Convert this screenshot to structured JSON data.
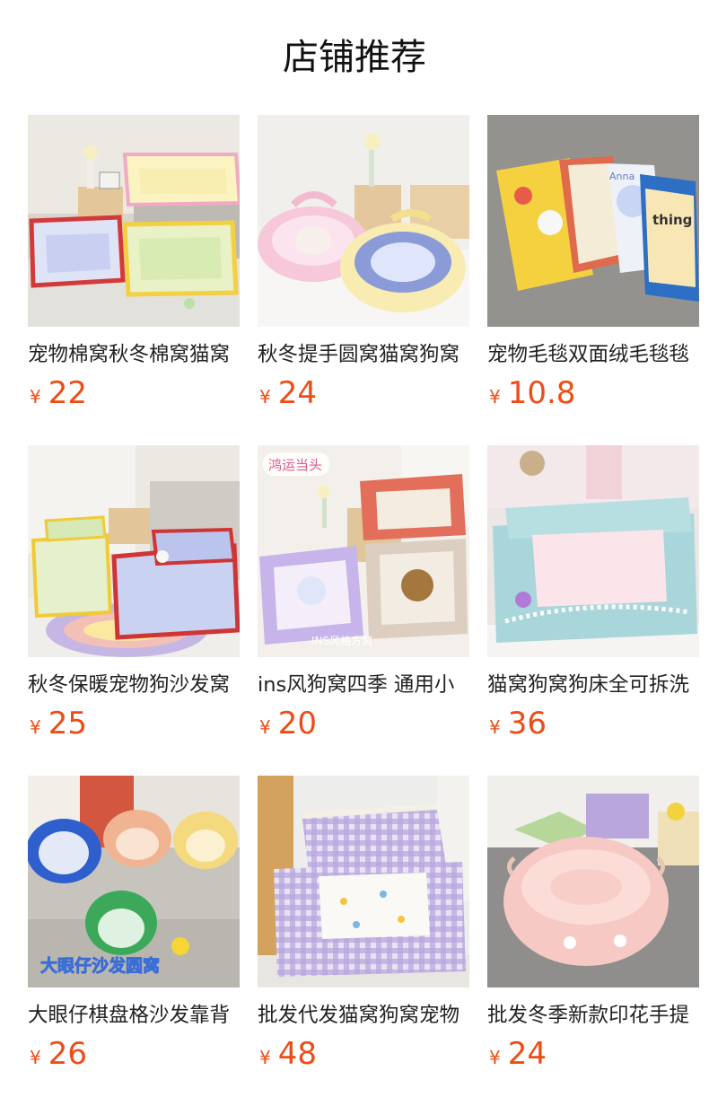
{
  "section_title": "店铺推荐",
  "currency_symbol": "¥",
  "accent_price_color": "#ee4c15",
  "products": [
    {
      "name": "宠物棉窝秋冬棉窝猫窝",
      "price": "22",
      "image_icon": "pet-bed-plaid-icon"
    },
    {
      "name": "秋冬提手圆窝猫窝狗窝",
      "price": "24",
      "image_icon": "round-pet-bed-icon"
    },
    {
      "name": "宠物毛毯双面绒毛毯毯",
      "price": "10.8",
      "image_icon": "pet-blanket-icon"
    },
    {
      "name": "秋冬保暖宠物狗沙发窝",
      "price": "25",
      "image_icon": "pet-sofa-icon"
    },
    {
      "name": "ins风狗窝四季 通用小",
      "price": "20",
      "image_icon": "pet-bed-icon"
    },
    {
      "name": "猫窝狗窝狗床全可拆洗",
      "price": "36",
      "image_icon": "pet-bed-lace-icon"
    },
    {
      "name": "大眼仔棋盘格沙发靠背",
      "price": "26",
      "image_icon": "checkered-pet-sofa-icon"
    },
    {
      "name": "批发代发猫窝狗窝宠物",
      "price": "48",
      "image_icon": "gingham-pet-bed-icon"
    },
    {
      "name": "批发冬季新款印花手提",
      "price": "24",
      "image_icon": "round-pink-pet-bed-icon"
    }
  ],
  "image_overlays": {
    "p2_top_tag": "鸿运当头",
    "p2_bottom_tag": "INS风格方窝",
    "p3_caption": "大眼仔沙发圆窝",
    "p1_blanket_text": "thing",
    "p1_blanket_script": "Anna"
  }
}
